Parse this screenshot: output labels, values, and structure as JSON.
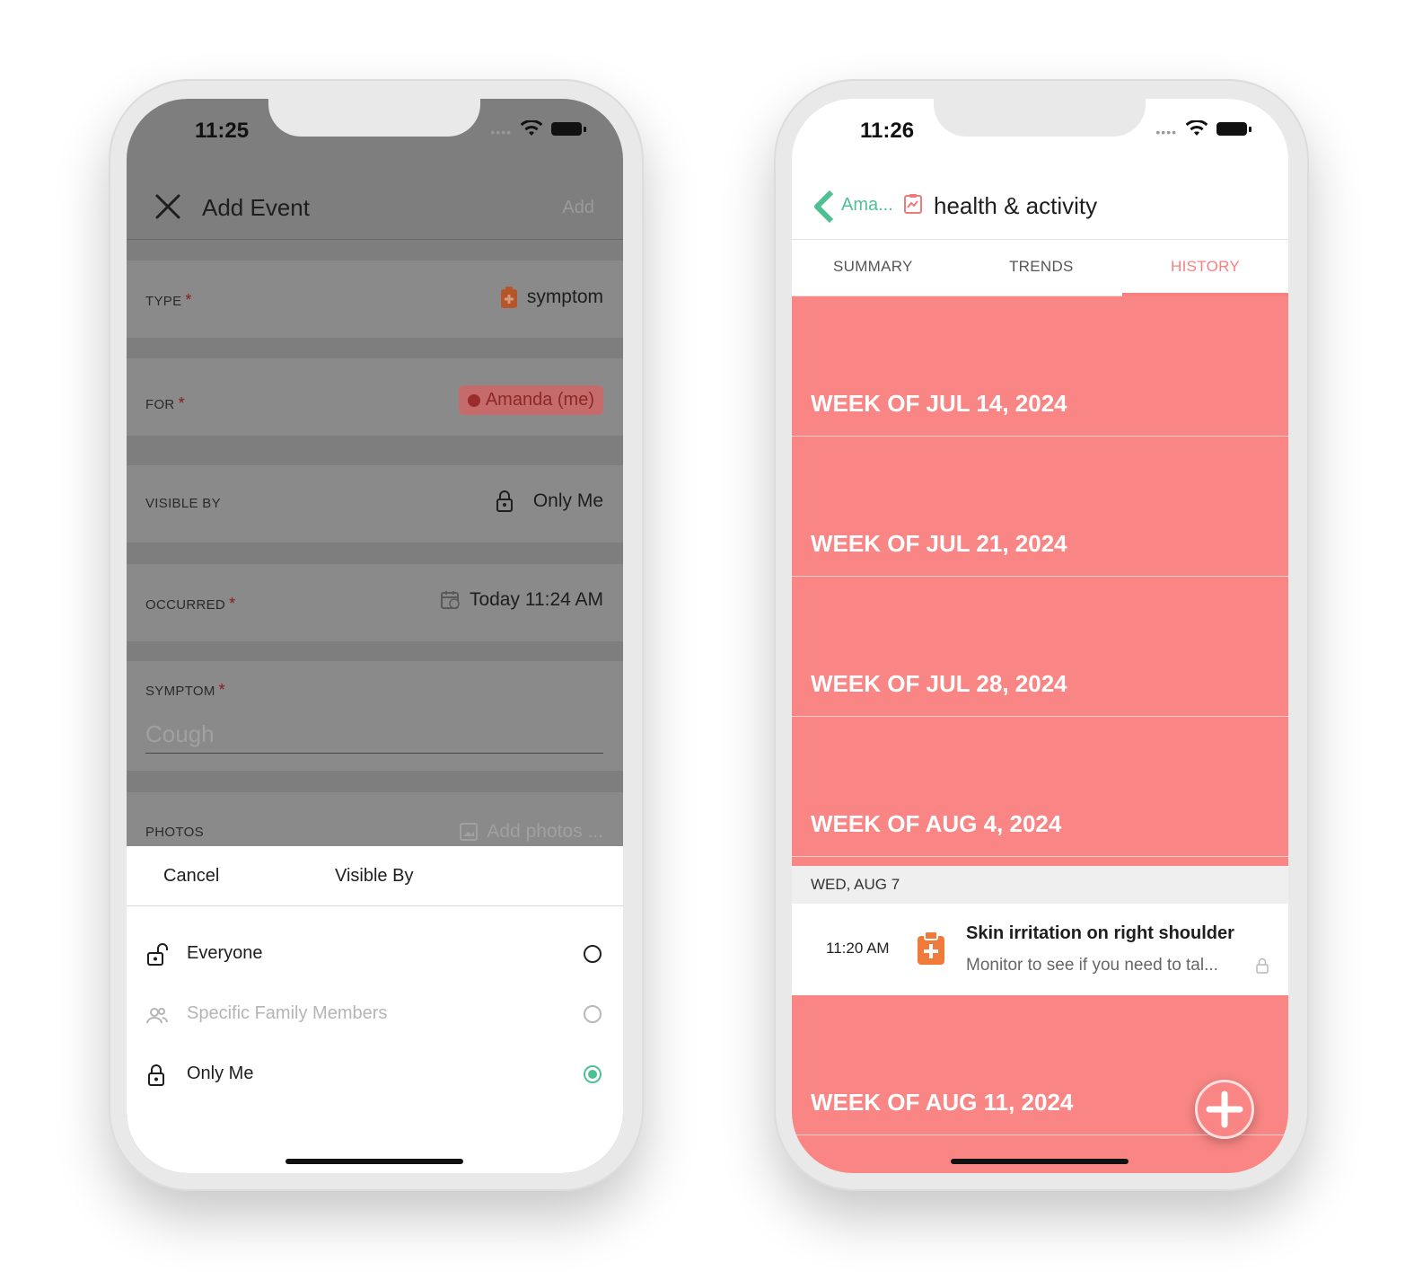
{
  "left_phone": {
    "status_time": "11:25",
    "nav": {
      "title": "Add Event",
      "add_label": "Add"
    },
    "fields": {
      "type": {
        "label": "TYPE",
        "value": "symptom"
      },
      "for": {
        "label": "FOR",
        "value": "Amanda (me)"
      },
      "visible_by": {
        "label": "VISIBLE BY",
        "value": "Only Me"
      },
      "occurred": {
        "label": "OCCURRED",
        "value": "Today 11:24 AM"
      },
      "symptom": {
        "label": "SYMPTOM",
        "value": "Cough"
      },
      "photos": {
        "label": "PHOTOS",
        "value": "Add photos ..."
      }
    },
    "required_mark": "*",
    "sheet": {
      "cancel_label": "Cancel",
      "title": "Visible By",
      "options": [
        {
          "label": "Everyone",
          "icon": "unlock-icon",
          "selected": false,
          "enabled": true
        },
        {
          "label": "Specific Family Members",
          "icon": "people-icon",
          "selected": false,
          "enabled": false
        },
        {
          "label": "Only Me",
          "icon": "lock-icon",
          "selected": true,
          "enabled": true
        }
      ]
    }
  },
  "right_phone": {
    "status_time": "11:26",
    "nav": {
      "back_label": "Ama...",
      "title": "health & activity"
    },
    "tabs": [
      "SUMMARY",
      "TRENDS",
      "HISTORY"
    ],
    "active_tab": "HISTORY",
    "weeks": [
      "WEEK OF JUL 14, 2024",
      "WEEK OF JUL 21, 2024",
      "WEEK OF JUL 28, 2024",
      "WEEK OF AUG 4, 2024",
      "WEEK OF AUG 11, 2024"
    ],
    "day_header": "WED,  AUG 7",
    "entry": {
      "time": "11:20 AM",
      "title": "Skin irritation on right shoulder",
      "subtitle": "Monitor to see if you need to tal..."
    }
  },
  "colors": {
    "accent_green": "#4fbf94",
    "history_bg": "#f98684",
    "symptom_orange": "#f07a3a",
    "required_red": "#8b1a1a"
  }
}
